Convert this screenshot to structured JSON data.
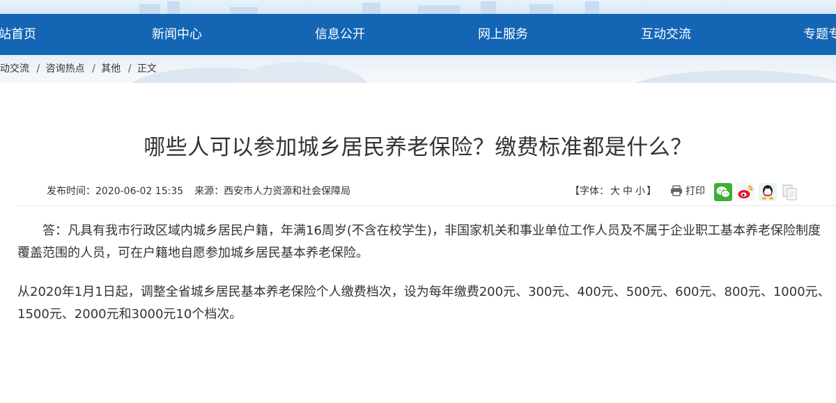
{
  "nav": {
    "items": [
      "站首页",
      "新闻中心",
      "信息公开",
      "网上服务",
      "互动交流",
      "专题专"
    ]
  },
  "breadcrumb": {
    "items": [
      "动交流",
      "咨询热点",
      "其他",
      "正文"
    ],
    "separator": "/"
  },
  "article": {
    "title": "哪些人可以参加城乡居民养老保险？缴费标准都是什么？",
    "publish_label": "发布时间：",
    "publish_time": "2020-06-02 15:35",
    "source_label": "来源：",
    "source": "西安市人力资源和社会保障局",
    "font_label_open": "【字体：",
    "font_sizes": [
      "大",
      "中",
      "小"
    ],
    "font_label_close": "】",
    "print_label": "打印",
    "paragraphs": [
      "答：凡具有我市行政区域内城乡居民户籍，年满16周岁(不含在校学生)，非国家机关和事业单位工作人员及不属于企业职工基本养老保险制度覆盖范围的人员，可在户籍地自愿参加城乡居民基本养老保险。",
      "从2020年1月1日起，调整全省城乡居民基本养老保险个人缴费档次，设为每年缴费200元、300元、400元、500元、600元、800元、1000元、1500元、2000元和3000元10个档次。"
    ]
  },
  "share": {
    "icons": [
      "wechat-icon",
      "weibo-icon",
      "qq-icon",
      "copy-icon"
    ]
  },
  "colors": {
    "nav_bg": "#1466b5",
    "nav_text": "#ffffff",
    "body_text": "#333333",
    "wechat": "#3cb034",
    "weibo": "#e6162d",
    "qq_blue": "#1aa3e8"
  }
}
